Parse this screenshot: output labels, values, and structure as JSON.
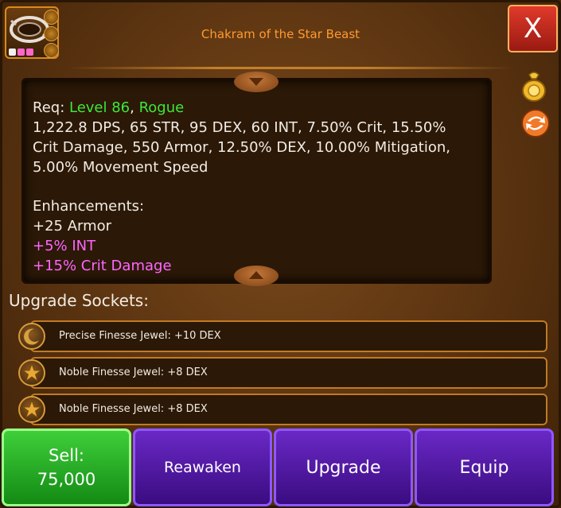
{
  "item": {
    "title": "Chakram of the Star Beast"
  },
  "close": {
    "label": "X"
  },
  "stats": {
    "req_prefix": "Req: ",
    "level": "Level 86",
    "req_sep": ", ",
    "class": "Rogue",
    "line1": "1,222.8 DPS, 65 STR, 95 DEX, 60 INT, 7.50% Crit, 15.50%",
    "line2": "Crit Damage, 550 Armor, 12.50% DEX, 10.00% Mitigation,",
    "line3": "5.00% Movement Speed",
    "enh_header": "Enhancements:",
    "enh1": "+25 Armor",
    "enh2": "+5% INT",
    "enh3": "+15% Crit Damage"
  },
  "sockets": {
    "label": "Upgrade Sockets:",
    "rows": [
      "Precise Finesse Jewel: +10 DEX",
      "Noble Finesse Jewel: +8 DEX",
      "Noble Finesse Jewel: +8 DEX"
    ]
  },
  "buttons": {
    "sell_label": "Sell:",
    "sell_price": "75,000",
    "reawaken": "Reawaken",
    "upgrade": "Upgrade",
    "equip": "Equip"
  },
  "icons": {
    "item": "chakram-icon",
    "gold": "gold-bag-icon",
    "swap": "swap-arrows-icon",
    "close": "close-icon"
  },
  "colors": {
    "title": "#ff9a2e",
    "requirement": "#3ee83a",
    "enhancement_bonus": "#ff66ff",
    "sell": "#2db52a",
    "action": "#4e1aa6"
  }
}
